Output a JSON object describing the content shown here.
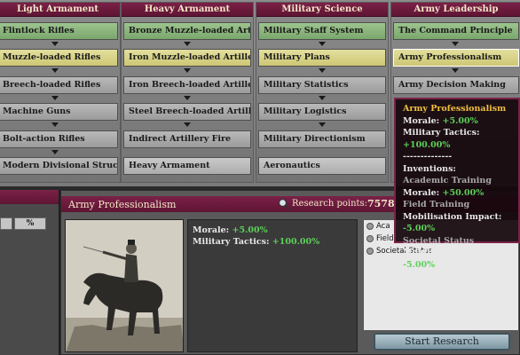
{
  "columns": [
    {
      "header": "Light Armament",
      "techs": [
        {
          "label": "Flintlock Rifles",
          "state": "done"
        },
        {
          "label": "Muzzle-loaded Rifles",
          "state": "avail"
        },
        {
          "label": "Breech-loaded Rifles",
          "state": "locked"
        },
        {
          "label": "Machine Guns",
          "state": "locked"
        },
        {
          "label": "Bolt-action Rifles",
          "state": "locked"
        },
        {
          "label": "Modern Divisional Structure",
          "state": "locked"
        }
      ]
    },
    {
      "header": "Heavy Armament",
      "techs": [
        {
          "label": "Bronze Muzzle-loaded Arti ...",
          "state": "done"
        },
        {
          "label": "Iron Muzzle-loaded Artillery",
          "state": "avail"
        },
        {
          "label": "Iron Breech-loaded Artillery",
          "state": "locked"
        },
        {
          "label": "Steel Breech-loaded Artillery",
          "state": "locked"
        },
        {
          "label": "Indirect Artillery Fire",
          "state": "locked"
        },
        {
          "label": "Heavy Armament",
          "state": "plain"
        }
      ]
    },
    {
      "header": "Military Science",
      "techs": [
        {
          "label": "Military Staff System",
          "state": "done"
        },
        {
          "label": "Military Plans",
          "state": "avail"
        },
        {
          "label": "Military Statistics",
          "state": "locked"
        },
        {
          "label": "Military Logistics",
          "state": "locked"
        },
        {
          "label": "Military Directionism",
          "state": "locked"
        },
        {
          "label": "Aeronautics",
          "state": "plain"
        }
      ]
    },
    {
      "header": "Army Leadership",
      "techs": [
        {
          "label": "The Command Principle",
          "state": "done"
        },
        {
          "label": "Army Professionalism",
          "state": "avail"
        },
        {
          "label": "Army Decision Making",
          "state": "locked"
        }
      ]
    }
  ],
  "left_panel": {
    "pct_label": "%"
  },
  "detail": {
    "title": "Army Professionalism",
    "research_points_label": "Research points:",
    "research_points_value": "7578",
    "effects": [
      {
        "label": "Morale:",
        "value": "+5.00%"
      },
      {
        "label": "Military Tactics:",
        "value": "+100.00%"
      }
    ],
    "inventions": [
      {
        "label": "Aca"
      },
      {
        "label": "Field"
      },
      {
        "label": "Societal Status"
      }
    ],
    "start_button": "Start Research"
  },
  "tooltip": {
    "title": "Army Professionalism",
    "effects": [
      {
        "label": "Morale:",
        "value": "+5.00%"
      },
      {
        "label": "Military Tactics:",
        "value": "+100.00%"
      }
    ],
    "separator": "--------------",
    "inventions_label": "Inventions:",
    "inventions": [
      {
        "name": "Academic Training",
        "effect_label": "Morale:",
        "effect_value": "+50.00%"
      },
      {
        "name": "Field Training",
        "effect_label": "Mobilisation Impact:",
        "effect_value": "-5.00%"
      },
      {
        "name": "Societal Status",
        "effect_label": "Mobilisation Impact:",
        "effect_value": "-5.00%"
      }
    ]
  }
}
